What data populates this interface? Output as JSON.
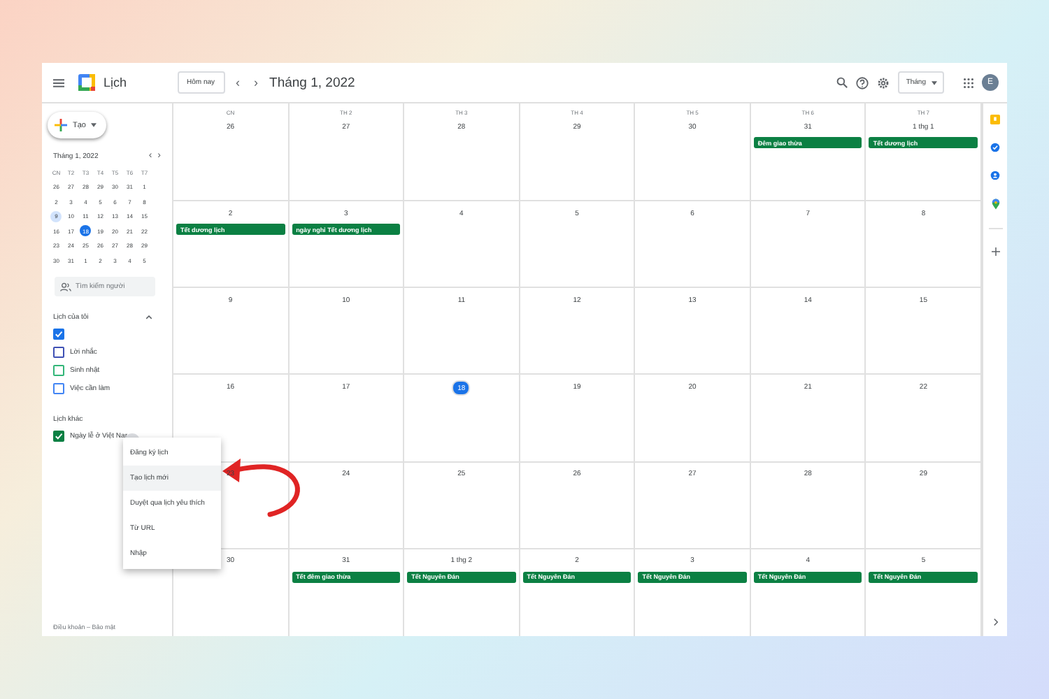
{
  "header": {
    "app_name": "Lịch",
    "today_button": "Hôm nay",
    "prev": "‹",
    "next": "›",
    "title": "Tháng 1, 2022",
    "view": "Tháng",
    "avatar": "E"
  },
  "sidebar": {
    "create": "Tạo",
    "mini_title": "Tháng 1, 2022",
    "weekdays": [
      "CN",
      "T2",
      "T3",
      "T4",
      "T5",
      "T6",
      "T7"
    ],
    "mini_days": [
      {
        "d": "26",
        "selected": false,
        "highlighted": false
      },
      {
        "d": "27",
        "selected": false,
        "highlighted": false
      },
      {
        "d": "28",
        "selected": false,
        "highlighted": false
      },
      {
        "d": "29",
        "selected": false,
        "highlighted": false
      },
      {
        "d": "30",
        "selected": false,
        "highlighted": false
      },
      {
        "d": "31",
        "selected": false,
        "highlighted": false
      },
      {
        "d": "1",
        "selected": false,
        "highlighted": false
      },
      {
        "d": "2",
        "selected": false,
        "highlighted": false
      },
      {
        "d": "3",
        "selected": false,
        "highlighted": false
      },
      {
        "d": "4",
        "selected": false,
        "highlighted": false
      },
      {
        "d": "5",
        "selected": false,
        "highlighted": false
      },
      {
        "d": "6",
        "selected": false,
        "highlighted": false
      },
      {
        "d": "7",
        "selected": false,
        "highlighted": false
      },
      {
        "d": "8",
        "selected": false,
        "highlighted": false
      },
      {
        "d": "9",
        "selected": false,
        "highlighted": true
      },
      {
        "d": "10",
        "selected": false,
        "highlighted": false
      },
      {
        "d": "11",
        "selected": false,
        "highlighted": false
      },
      {
        "d": "12",
        "selected": false,
        "highlighted": false
      },
      {
        "d": "13",
        "selected": false,
        "highlighted": false
      },
      {
        "d": "14",
        "selected": false,
        "highlighted": false
      },
      {
        "d": "15",
        "selected": false,
        "highlighted": false
      },
      {
        "d": "16",
        "selected": false,
        "highlighted": false
      },
      {
        "d": "17",
        "selected": false,
        "highlighted": false
      },
      {
        "d": "18",
        "selected": true,
        "highlighted": false
      },
      {
        "d": "19",
        "selected": false,
        "highlighted": false
      },
      {
        "d": "20",
        "selected": false,
        "highlighted": false
      },
      {
        "d": "21",
        "selected": false,
        "highlighted": false
      },
      {
        "d": "22",
        "selected": false,
        "highlighted": false
      },
      {
        "d": "23",
        "selected": false,
        "highlighted": false
      },
      {
        "d": "24",
        "selected": false,
        "highlighted": false
      },
      {
        "d": "25",
        "selected": false,
        "highlighted": false
      },
      {
        "d": "26",
        "selected": false,
        "highlighted": false
      },
      {
        "d": "27",
        "selected": false,
        "highlighted": false
      },
      {
        "d": "28",
        "selected": false,
        "highlighted": false
      },
      {
        "d": "29",
        "selected": false,
        "highlighted": false
      },
      {
        "d": "30",
        "selected": false,
        "highlighted": false
      },
      {
        "d": "31",
        "selected": false,
        "highlighted": false
      },
      {
        "d": "1",
        "selected": false,
        "highlighted": false
      },
      {
        "d": "2",
        "selected": false,
        "highlighted": false
      },
      {
        "d": "3",
        "selected": false,
        "highlighted": false
      },
      {
        "d": "4",
        "selected": false,
        "highlighted": false
      },
      {
        "d": "5",
        "selected": false,
        "highlighted": false
      }
    ],
    "search_people": {
      "placeholder": "Tìm kiếm người"
    },
    "my_calendars_title": "Lịch của tôi",
    "my_calendars": [
      {
        "color": "#1a73e8",
        "checked": true
      },
      {
        "label": "Lời nhắc",
        "color": "#3f51b5",
        "checked": false
      },
      {
        "label": "Sinh nhật",
        "color": "#33b679",
        "checked": false
      },
      {
        "label": "Việc cần làm",
        "color": "#4285f4",
        "checked": false
      }
    ],
    "other_calendars_title": "Lịch khác",
    "other_calendars": [
      {
        "label": "Ngày lễ ở Việt Nar",
        "color": "#0b8043",
        "checked": true
      }
    ],
    "footer": "Điều khoản – Bảo mật"
  },
  "grid": {
    "weekdays": [
      "CN",
      "TH 2",
      "TH 3",
      "TH 4",
      "TH 5",
      "TH 6",
      "TH 7"
    ],
    "weeks": [
      [
        {
          "date": "26",
          "today": false
        },
        {
          "date": "27",
          "today": false
        },
        {
          "date": "28",
          "today": false
        },
        {
          "date": "29",
          "today": false
        },
        {
          "date": "30",
          "today": false
        },
        {
          "date": "31",
          "today": false,
          "events": [
            "Đêm giao thừa"
          ]
        },
        {
          "date": "1 thg 1",
          "today": false,
          "events": [
            "Tết dương lịch"
          ]
        }
      ],
      [
        {
          "date": "2",
          "today": false,
          "events": [
            "Tết dương lịch"
          ]
        },
        {
          "date": "3",
          "today": false,
          "events": [
            "ngày nghỉ Tết dương lịch"
          ]
        },
        {
          "date": "4",
          "today": false
        },
        {
          "date": "5",
          "today": false
        },
        {
          "date": "6",
          "today": false
        },
        {
          "date": "7",
          "today": false
        },
        {
          "date": "8",
          "today": false
        }
      ],
      [
        {
          "date": "9",
          "today": false
        },
        {
          "date": "10",
          "today": false
        },
        {
          "date": "11",
          "today": false
        },
        {
          "date": "12",
          "today": false
        },
        {
          "date": "13",
          "today": false
        },
        {
          "date": "14",
          "today": false
        },
        {
          "date": "15",
          "today": false
        }
      ],
      [
        {
          "date": "16",
          "today": false
        },
        {
          "date": "17",
          "today": false
        },
        {
          "date": "18",
          "today": true
        },
        {
          "date": "19",
          "today": false
        },
        {
          "date": "20",
          "today": false
        },
        {
          "date": "21",
          "today": false
        },
        {
          "date": "22",
          "today": false
        }
      ],
      [
        {
          "date": "23",
          "today": false
        },
        {
          "date": "24",
          "today": false
        },
        {
          "date": "25",
          "today": false
        },
        {
          "date": "26",
          "today": false
        },
        {
          "date": "27",
          "today": false
        },
        {
          "date": "28",
          "today": false
        },
        {
          "date": "29",
          "today": false
        }
      ],
      [
        {
          "date": "30",
          "today": false
        },
        {
          "date": "31",
          "today": false,
          "events": [
            "Tết đêm giao thừa"
          ]
        },
        {
          "date": "1 thg 2",
          "today": false,
          "events": [
            "Tết Nguyên Đán"
          ]
        },
        {
          "date": "2",
          "today": false,
          "events": [
            "Tết Nguyên Đán"
          ]
        },
        {
          "date": "3",
          "today": false,
          "events": [
            "Tết Nguyên Đán"
          ]
        },
        {
          "date": "4",
          "today": false,
          "events": [
            "Tết Nguyên Đán"
          ]
        },
        {
          "date": "5",
          "today": false,
          "events": [
            "Tết Nguyên Đán"
          ]
        }
      ]
    ]
  },
  "menu": {
    "items": [
      {
        "label": "Đăng ký lịch",
        "selected": false
      },
      {
        "label": "Tạo lịch mới",
        "selected": true
      },
      {
        "label": "Duyệt qua lịch yêu thích",
        "selected": false
      },
      {
        "label": "Từ URL",
        "selected": false
      },
      {
        "label": "Nhập",
        "selected": false
      }
    ]
  }
}
